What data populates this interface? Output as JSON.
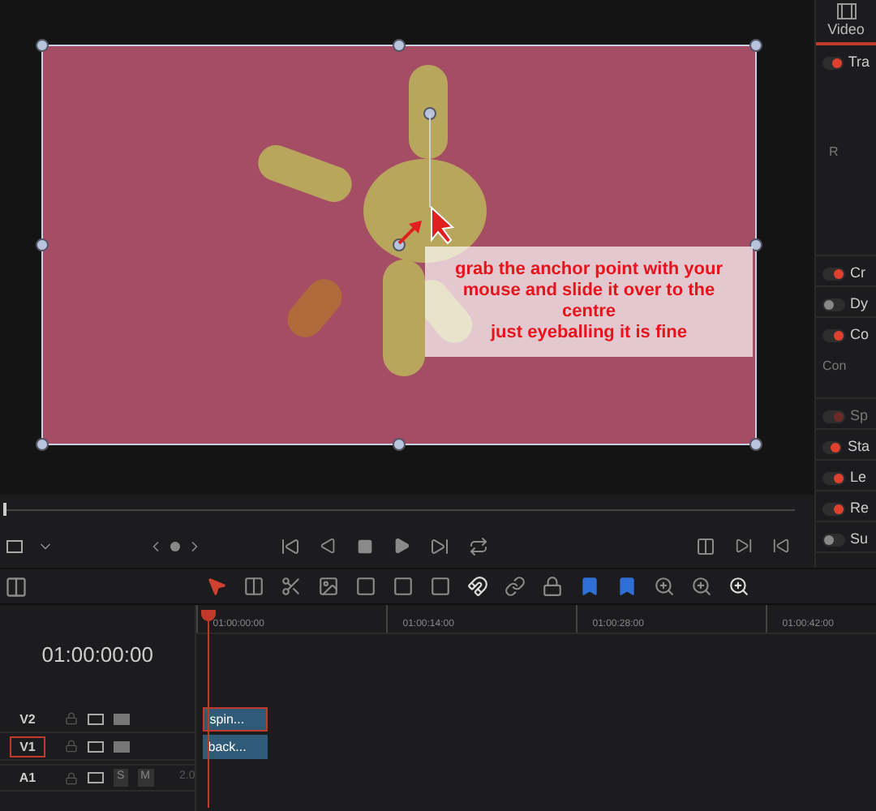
{
  "viewer": {
    "annotation": "grab the anchor point with your mouse and slide it over to the centre\njust eyeballing it is fine"
  },
  "inspector": {
    "tab": "Video",
    "rows": [
      {
        "label": "Tra",
        "on": true,
        "disabled": false,
        "sub": "R"
      },
      {
        "label": "Cr",
        "on": true,
        "disabled": false
      },
      {
        "label": "Dy",
        "on": false,
        "disabled": false
      },
      {
        "label": "Co",
        "on": true,
        "disabled": false,
        "sub": "Con"
      },
      {
        "label": "Sp",
        "on": true,
        "disabled": true
      },
      {
        "label": "Sta",
        "on": true,
        "disabled": false
      },
      {
        "label": "Le",
        "on": true,
        "disabled": false
      },
      {
        "label": "Re",
        "on": true,
        "disabled": false
      },
      {
        "label": "Su",
        "on": false,
        "disabled": false
      }
    ]
  },
  "timeline": {
    "timecode": "01:00:00:00",
    "ruler": [
      "01:00:00:00",
      "01:00:14:00",
      "01:00:28:00",
      "01:00:42:00"
    ],
    "tracks": [
      {
        "name": "V2",
        "kind": "video",
        "selected": false,
        "clip": "spin..."
      },
      {
        "name": "V1",
        "kind": "video",
        "selected": true,
        "clip": "back..."
      },
      {
        "name": "A1",
        "kind": "audio",
        "selected": false,
        "solo": "S",
        "mute": "M",
        "level_text": "2.0"
      }
    ]
  }
}
